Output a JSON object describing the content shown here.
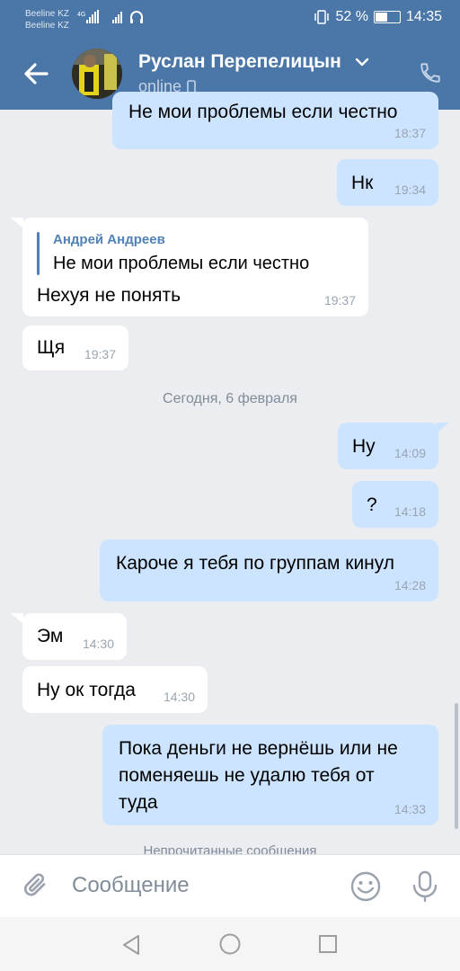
{
  "status_bar": {
    "carrier1": "Beeline KZ",
    "carrier2": "Beeline KZ",
    "battery": "52 %",
    "time": "14:35",
    "battery_level": 0.52
  },
  "header": {
    "contact_name": "Руслан Перепелицын",
    "status": "online",
    "back_icon": "arrow-left-icon",
    "call_icon": "phone-icon"
  },
  "messages": [
    {
      "dir": "out",
      "text": "Не мои проблемы если честно",
      "time": "18:37"
    },
    {
      "dir": "out",
      "text": "Нк",
      "time": "19:34"
    },
    {
      "dir": "in",
      "reply_author": "Андрей Андреев",
      "reply_text": "Не мои проблемы если честно",
      "text": "Нехуя не понять",
      "time": "19:37"
    },
    {
      "dir": "in",
      "text": "Щя",
      "time": "19:37"
    },
    {
      "dir": "out",
      "text": "Ну",
      "time": "14:09"
    },
    {
      "dir": "out",
      "text": "?",
      "time": "14:18"
    },
    {
      "dir": "out",
      "text": "Кароче я тебя по группам кинул",
      "time": "14:28"
    },
    {
      "dir": "in",
      "text": "Эм",
      "time": "14:30"
    },
    {
      "dir": "in",
      "text": "Ну ок тогда",
      "time": "14:30"
    },
    {
      "dir": "out",
      "text_lines": [
        "Пока деньги не вернёшь или не",
        "поменяешь не удалю тебя от",
        "туда"
      ],
      "time": "14:33"
    }
  ],
  "date_separator": "Сегодня, 6 февраля",
  "unread_label": "Непрочитанные сообщения",
  "composer": {
    "placeholder": "Сообщение",
    "attach_icon": "paperclip-icon",
    "emoji_icon": "smile-icon",
    "voice_icon": "microphone-icon"
  },
  "navbar": {
    "back": "triangle-back-icon",
    "home": "circle-home-icon",
    "recents": "square-recents-icon"
  },
  "colors": {
    "header": "#4a76a8",
    "outgoing": "#cce4ff",
    "incoming": "#ffffff",
    "background": "#ebedf0"
  }
}
